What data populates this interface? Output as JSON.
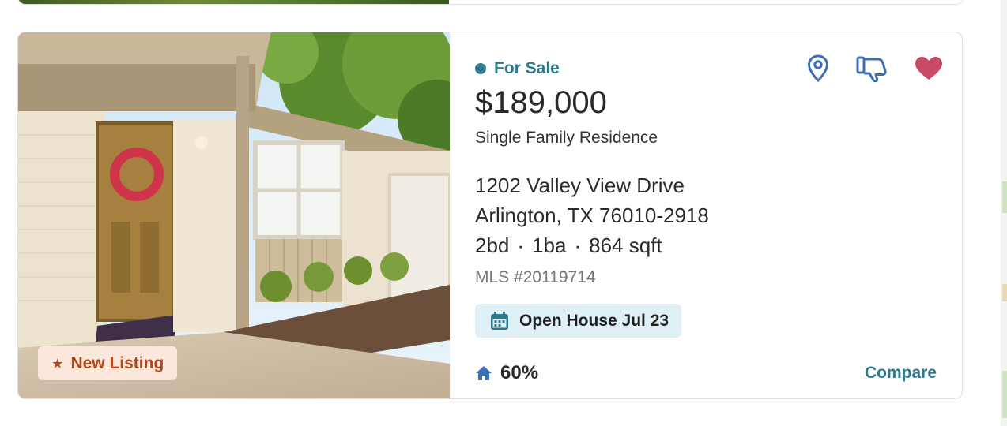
{
  "listing": {
    "status": "For Sale",
    "price": "$189,000",
    "property_type": "Single Family Residence",
    "address_line1": "1202 Valley View Drive",
    "address_line2": "Arlington, TX 76010-2918",
    "beds": "2bd",
    "baths": "1ba",
    "sqft": "864 sqft",
    "separator": "·",
    "mls": "MLS #20119714",
    "open_house": "Open House Jul 23",
    "match_score": "60%",
    "badge": "New Listing",
    "compare_label": "Compare"
  },
  "icons": {
    "map_pin": "map-pin-icon",
    "dislike": "thumbs-down-icon",
    "favorite": "heart-icon",
    "calendar": "calendar-icon",
    "home": "home-icon",
    "star": "star-icon"
  },
  "colors": {
    "accent": "#2f7a8e",
    "pin_blue": "#3d6fb5",
    "heart": "#c94a66",
    "badge_bg": "#fbe7dc",
    "badge_text": "#b2491a",
    "open_house_bg": "#dff0f6"
  }
}
